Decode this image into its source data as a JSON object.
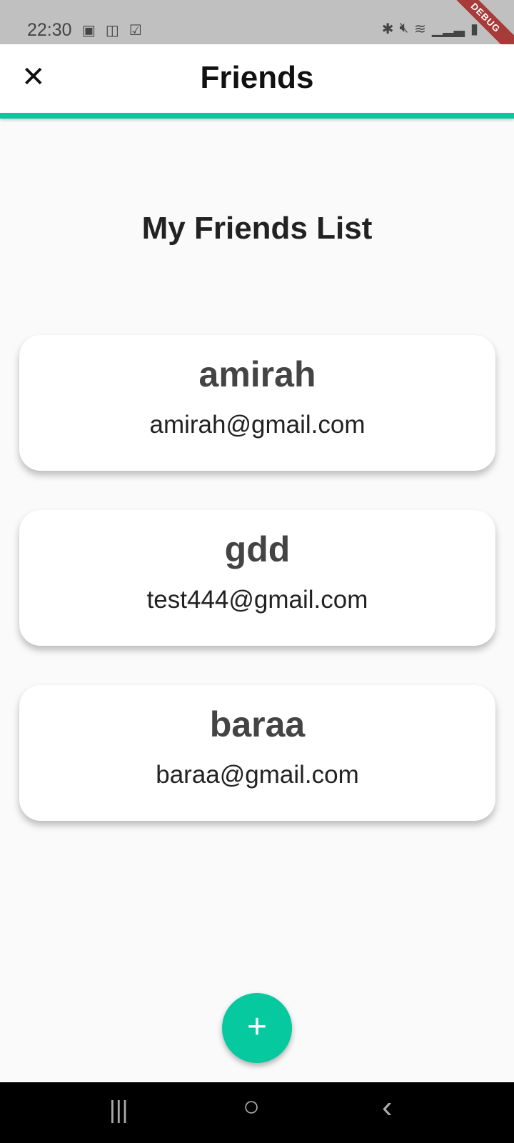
{
  "status_bar": {
    "time": "22:30",
    "icons": [
      "image-icon",
      "video-icon",
      "check-icon",
      "bluetooth-icon",
      "mute-icon",
      "wifi-icon",
      "signal-icon",
      "battery-icon"
    ]
  },
  "debug_banner": "DEBUG",
  "app_bar": {
    "title": "Friends",
    "close_icon": "close-icon",
    "accent_color": "#06c9a0"
  },
  "heading": "My Friends List",
  "friends": [
    {
      "name": "amirah",
      "email": "amirah@gmail.com"
    },
    {
      "name": "gdd",
      "email": "test444@gmail.com"
    },
    {
      "name": "baraa",
      "email": "baraa@gmail.com"
    }
  ],
  "fab": {
    "icon": "plus-icon",
    "label": "+"
  },
  "nav": {
    "recents": "|||",
    "home": "○",
    "back": "‹"
  }
}
